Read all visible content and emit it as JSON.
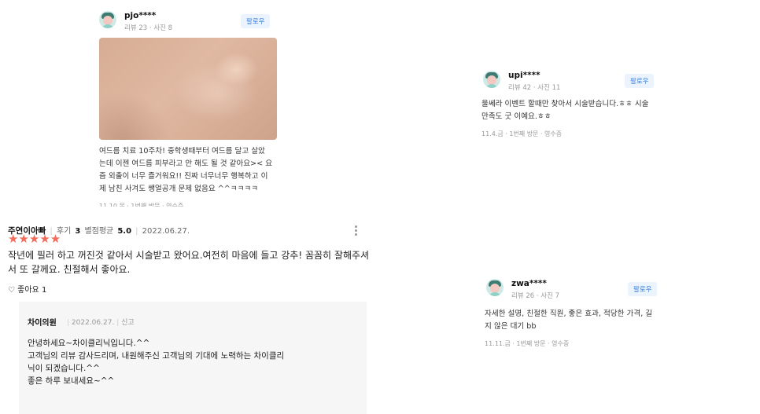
{
  "review_pjo": {
    "nickname": "pjo****",
    "meta": "리뷰 23 · 사진 8",
    "follow_label": "팔로우",
    "text": "여드름 치료 10주차! 중학생때부터 여드름 달고 살았\n는데 이젠 여드름 피부라고 안 해도 될 것 같아요>< 요\n즘 외출이 너무 즐거워요!! 진짜 너무너무 행복하고 이\n제 남친 사겨도 쌩얼공개 문제 없음요 ^^ㅋㅋㅋㅋ",
    "footer": "11.10.목 · 1번째 방문 · 영수증"
  },
  "review_upi": {
    "nickname": "upi****",
    "meta": "리뷰 42 · 사진 11",
    "follow_label": "팔로우",
    "text": "울쎄라 이벤트 할때만 찾아서 시술받습니다.ㅎㅎ 시술\n만족도 굿 이예요.ㅎㅎ",
    "footer": "11.4.금 · 1번째 방문 · 영수증"
  },
  "review_zwa": {
    "nickname": "zwa****",
    "meta": "리뷰 26 · 사진 7",
    "follow_label": "팔로우",
    "text": "자세한 설명, 친절한 직원, 좋은 효과, 적당한 가격, 길\n지 않은 대기 bb",
    "footer": "11.11.금 · 1번째 방문 · 영수증"
  },
  "main_review": {
    "author": "주연이아빠",
    "review_count_label": "후기",
    "review_count": "3",
    "avg_label": "별점평균",
    "avg": "5.0",
    "date": "2022.06.27.",
    "stars": "★★★★★",
    "text": "작년에 필러 하고 꺼진것 같아서 시술받고 왔어요.여전히 마음에 들고 강추! 꼼꼼히 잘해주셔서 또 갈께요. 친절해서 좋아요.",
    "like_label": "좋아요",
    "like_count": "1",
    "like_icon": "♡"
  },
  "reply": {
    "author": "차이의원",
    "date": "2022.06.27.",
    "report_label": "신고",
    "text": "안녕하세요~차이클리닉입니다.^^\n고객님의 리뷰 감사드리며, 내원해주신 고객님의 기대에 노력하는 차이클리\n닉이 되겠습니다.^^\n좋은 하루 보내세요~^^"
  },
  "colors": {
    "star": "#f26b5b",
    "follow_text": "#3c7fd9",
    "follow_bg": "#eaf3fe",
    "reply_bg": "#f6f6f6"
  }
}
